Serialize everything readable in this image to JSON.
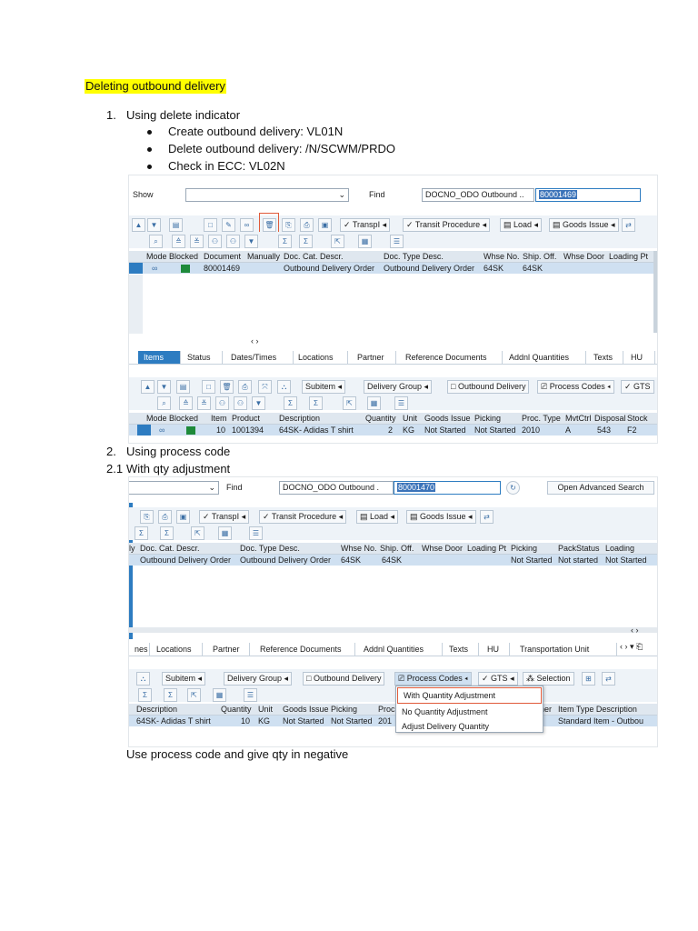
{
  "heading": "Deleting outbound delivery",
  "step1": {
    "num": "1.",
    "text": "Using delete indicator"
  },
  "bullets": [
    "Create outbound delivery: VL01N",
    "Delete outbound delivery: /N/SCWM/PRDO",
    "Check in ECC: VL02N"
  ],
  "shot1": {
    "show_label": "Show",
    "find_label": "Find",
    "find_select": "DOCNO_ODO Outbound ..",
    "find_value": "80001469",
    "toolbar1": {
      "transpl": "TranspI",
      "transit": "Transit Procedure",
      "load": "Load",
      "goods_issue": "Goods Issue"
    },
    "columns": [
      "Mode",
      "Blocked",
      "Document",
      "Manually",
      "Doc. Cat. Descr.",
      "Doc. Type Desc.",
      "Whse No.",
      "Ship. Off.",
      "Whse Door",
      "Loading Pt"
    ],
    "row": {
      "document": "80001469",
      "cat": "Outbound Delivery Order",
      "type": "Outbound Delivery Order",
      "whse": "64SK",
      "ship": "64SK"
    },
    "tabs": [
      "Items",
      "Status",
      "Dates/Times",
      "Locations",
      "Partner",
      "Reference Documents",
      "Addnl Quantities",
      "Texts",
      "HU"
    ],
    "toolbar2": {
      "subitem": "Subitem",
      "delivery_group": "Delivery Group",
      "outbound_delivery": "Outbound Delivery",
      "process_codes": "Process Codes",
      "gts": "GTS"
    },
    "item_columns": [
      "Mode",
      "Blocked",
      "Item",
      "Product",
      "Description",
      "Quantity",
      "Unit",
      "Goods Issue",
      "Picking",
      "Proc. Type",
      "MvtCtrl",
      "Disposal",
      "Stock"
    ],
    "item_row": {
      "item": "10",
      "product": "1001394",
      "desc": "64SK- Adidas T shirt",
      "qty": "2",
      "unit": "KG",
      "gi": "Not Started",
      "picking": "Not Started",
      "proc": "2010",
      "mvt": "A",
      "disp": "543",
      "stock": "F2"
    }
  },
  "step2": {
    "num": "2.",
    "text": "Using process code"
  },
  "step21": {
    "num": "2.1",
    "text": "With qty adjustment"
  },
  "shot2": {
    "find_label": "Find",
    "find_select": "DOCNO_ODO Outbound .",
    "find_value": "80001470",
    "adv_search": "Open Advanced Search",
    "toolbar1": {
      "transpl": "TranspI",
      "transit": "Transit Procedure",
      "load": "Load",
      "goods_issue": "Goods Issue"
    },
    "columns": [
      "ly",
      "Doc. Cat. Descr.",
      "Doc. Type Desc.",
      "Whse No.",
      "Ship. Off.",
      "Whse Door",
      "Loading Pt",
      "Picking",
      "PackStatus",
      "Loading"
    ],
    "row": {
      "cat": "Outbound Delivery Order",
      "type": "Outbound Delivery Order",
      "whse": "64SK",
      "ship": "64SK",
      "picking": "Not Started",
      "pack": "Not started",
      "loading": "Not Started"
    },
    "tabs": [
      "nes",
      "Locations",
      "Partner",
      "Reference Documents",
      "Addnl Quantities",
      "Texts",
      "HU",
      "Transportation Unit"
    ],
    "toolbar2": {
      "subitem": "Subitem",
      "delivery_group": "Delivery Group",
      "outbound_delivery": "Outbound Delivery",
      "process_codes": "Process Codes",
      "gts": "GTS",
      "selection": "Selection"
    },
    "item_columns": [
      "Description",
      "Quantity",
      "Unit",
      "Goods Issue",
      "Picking",
      "Proc",
      "ner",
      "Item Type Description"
    ],
    "item_row": {
      "desc": "64SK- Adidas T shirt",
      "qty": "10",
      "unit": "KG",
      "gi": "Not Started",
      "picking": "Not Started",
      "proc": "201",
      "type": "Standard Item - Outbou"
    },
    "menu": [
      "With Quantity Adjustment",
      "No Quantity Adjustment",
      "Adjust Delivery Quantity"
    ]
  },
  "footer_text": "Use process code and give qty in negative"
}
